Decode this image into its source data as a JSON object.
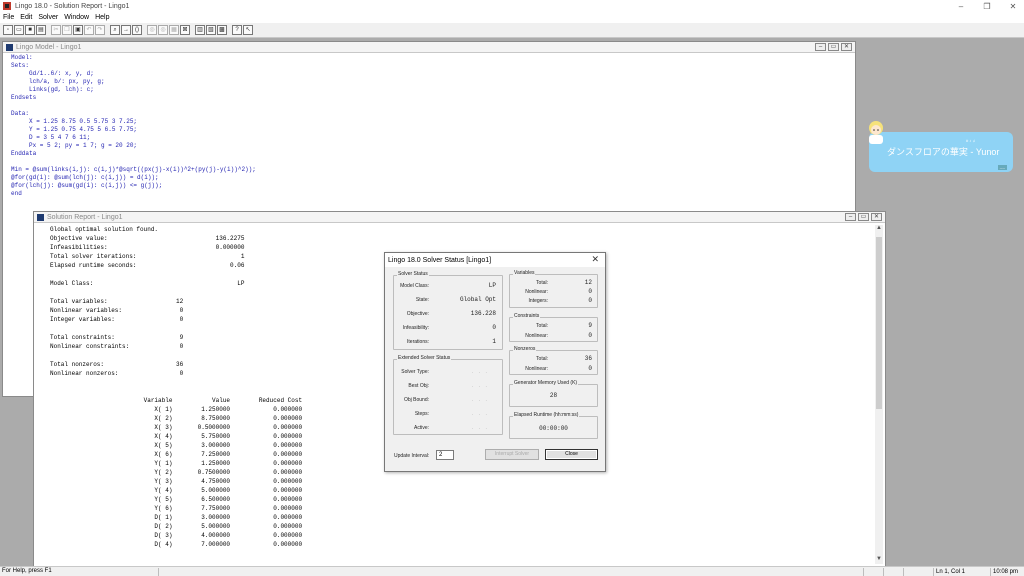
{
  "app": {
    "title": "Lingo 18.0 - Solution Report - Lingo1"
  },
  "window_controls": [
    "–",
    "❐",
    "✕"
  ],
  "menu": [
    "File",
    "Edit",
    "Solver",
    "Window",
    "Help"
  ],
  "toolbar_icons": [
    "new-icon",
    "open-icon",
    "save-icon",
    "print-icon",
    "cut-icon",
    "copy-icon",
    "paste-icon",
    "undo-icon",
    "redo-icon",
    "find-icon",
    "goto-icon",
    "match-paren-icon",
    "solve-icon",
    "solution-icon",
    "matrix-icon",
    "options-icon",
    "tile-icon",
    "cascade-icon",
    "close-all-icon",
    "help-icon",
    "context-help-icon"
  ],
  "model_window": {
    "title": "Lingo Model - Lingo1",
    "lines": [
      "Model:",
      "Sets:",
      "     Gd/1..6/: x, y, d;",
      "     lch/a, b/: px, py, g;",
      "     Links(gd, lch): c;",
      "Endsets",
      "",
      "Data:",
      "     X = 1.25 8.75 0.5 5.75 3 7.25;",
      "     Y = 1.25 0.75 4.75 5 6.5 7.75;",
      "     D = 3 5 4 7 6 11;",
      "     Px = 5 2; py = 1 7; g = 20 20;",
      "Enddata",
      "",
      "Min = @sum(links(i,j): c(i,j)*@sqrt((px(j)-x(i))^2+(py(j)-y(i))^2));",
      "@for(gd(i): @sum(lch(j): c(i,j)) = d(i));",
      "@for(lch(j): @sum(gd(i): c(i,j)) <= g(j));",
      "end"
    ]
  },
  "report_window": {
    "title": "Solution Report - Lingo1",
    "lines": [
      "Global optimal solution found.",
      "Objective value:                              136.2275",
      "Infeasibilities:                              0.000000",
      "Total solver iterations:                             1",
      "Elapsed runtime seconds:                          0.06",
      "",
      "Model Class:                                        LP",
      "",
      "Total variables:                   12",
      "Nonlinear variables:                0",
      "Integer variables:                  0",
      "",
      "Total constraints:                  9",
      "Nonlinear constraints:              0",
      "",
      "Total nonzeros:                    36",
      "Nonlinear nonzeros:                 0",
      "",
      "",
      "                          Variable           Value        Reduced Cost",
      "                             X( 1)        1.250000            0.000000",
      "                             X( 2)        8.750000            0.000000",
      "                             X( 3)       0.5000000            0.000000",
      "                             X( 4)        5.750000            0.000000",
      "                             X( 5)        3.000000            0.000000",
      "                             X( 6)        7.250000            0.000000",
      "                             Y( 1)        1.250000            0.000000",
      "                             Y( 2)       0.7500000            0.000000",
      "                             Y( 3)        4.750000            0.000000",
      "                             Y( 4)        5.000000            0.000000",
      "                             Y( 5)        6.500000            0.000000",
      "                             Y( 6)        7.750000            0.000000",
      "                             D( 1)        3.000000            0.000000",
      "                             D( 2)        5.000000            0.000000",
      "                             D( 3)        4.000000            0.000000",
      "                             D( 4)        7.000000            0.000000"
    ]
  },
  "notification": {
    "text": "ダンスフロアの華実 - Yunor",
    "small_label": "# ♪ ♫",
    "tag": "----"
  },
  "dialog": {
    "title": "Lingo 18.0 Solver Status [Lingo1]",
    "solver_status": {
      "label": "Solver Status",
      "rows": [
        {
          "label": "Model Class:",
          "value": "LP"
        },
        {
          "label": "State:",
          "value": "Global Opt"
        },
        {
          "label": "Objective:",
          "value": "136.228"
        },
        {
          "label": "Infeasibility:",
          "value": "0"
        },
        {
          "label": "Iterations:",
          "value": "1"
        }
      ]
    },
    "extended": {
      "label": "Extended Solver Status",
      "rows": [
        {
          "label": "Solver Type:",
          "value": ". . ."
        },
        {
          "label": "Best Obj:",
          "value": ". . ."
        },
        {
          "label": "Obj Bound:",
          "value": ". . ."
        },
        {
          "label": "Steps:",
          "value": ". . ."
        },
        {
          "label": "Active:",
          "value": ". . ."
        }
      ]
    },
    "variables": {
      "label": "Variables",
      "rows": [
        {
          "label": "Total:",
          "value": "12"
        },
        {
          "label": "Nonlinear:",
          "value": "0"
        },
        {
          "label": "Integers:",
          "value": "0"
        }
      ]
    },
    "constraints": {
      "label": "Constraints",
      "rows": [
        {
          "label": "Total:",
          "value": "9"
        },
        {
          "label": "Nonlinear:",
          "value": "0"
        }
      ]
    },
    "nonzeros": {
      "label": "Nonzeros",
      "rows": [
        {
          "label": "Total:",
          "value": "36"
        },
        {
          "label": "Nonlinear:",
          "value": "0"
        }
      ]
    },
    "memory": {
      "label": "Generator Memory Used (K)",
      "value": "28"
    },
    "runtime": {
      "label": "Elapsed Runtime (hh:mm:ss)",
      "value": "00:00:00"
    },
    "update_interval_label": "Update Interval:",
    "update_interval_value": "2",
    "interrupt_label": "Interrupt Solver",
    "close_label": "Close"
  },
  "statusbar": {
    "help": "For Help, press F1",
    "position": "Ln 1, Col 1",
    "time": "10:08 pm"
  }
}
